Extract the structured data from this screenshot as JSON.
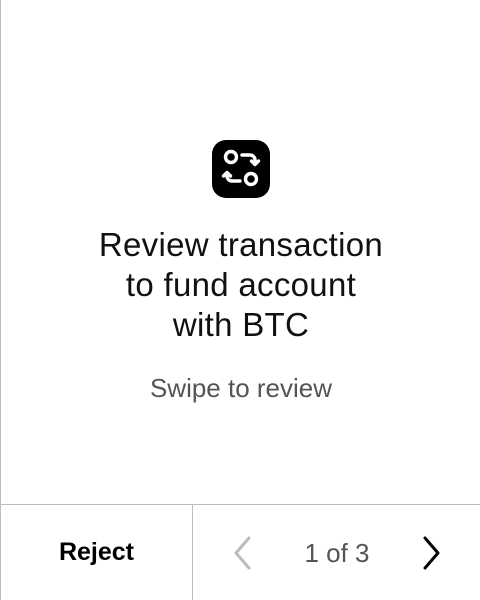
{
  "review": {
    "icon": "swap-arrows-icon",
    "title_line1": "Review transaction",
    "title_line2": "to fund account",
    "title_line3": "with BTC",
    "subtitle": "Swipe to review"
  },
  "footer": {
    "reject_label": "Reject",
    "page_indicator": "1 of 3",
    "prev_icon": "chevron-left-icon",
    "next_icon": "chevron-right-icon"
  },
  "colors": {
    "background": "#ffffff",
    "text_primary": "#111111",
    "text_secondary": "#555555",
    "divider": "#bdbdbd",
    "icon_background": "#000000",
    "disabled": "#bbbbbb"
  }
}
